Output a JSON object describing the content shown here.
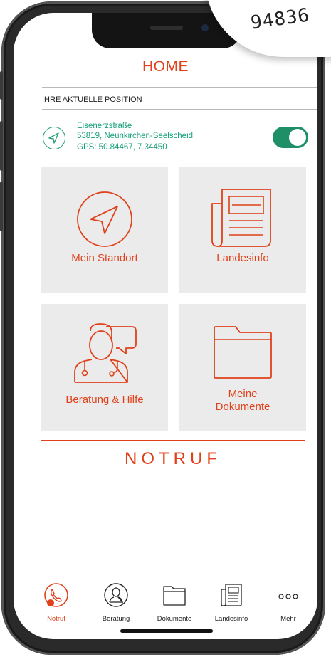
{
  "sticker": {
    "text": "94836"
  },
  "header": {
    "title": "HOME"
  },
  "position": {
    "label": "IHRE AKTUELLE POSITION",
    "street": "Eisenerzstraße",
    "city": "53819, Neunkirchen-Seelscheid",
    "gps": "GPS: 50.84467, 7.34450",
    "location_enabled": true
  },
  "tiles": [
    {
      "label": "Mein Standort",
      "icon": "navigation-arrow-icon"
    },
    {
      "label": "Landesinfo",
      "icon": "newspaper-icon"
    },
    {
      "label": "Beratung & Hilfe",
      "icon": "doctor-chat-icon"
    },
    {
      "label": "Meine Dokumente",
      "icon": "folder-icon"
    }
  ],
  "emergency": {
    "label": "NOTRUF"
  },
  "tabbar": {
    "items": [
      {
        "label": "Notruf",
        "icon": "phone-icon",
        "active": true
      },
      {
        "label": "Beratung",
        "icon": "doctor-icon",
        "active": false
      },
      {
        "label": "Dokumente",
        "icon": "folder-icon",
        "active": false
      },
      {
        "label": "Landesinfo",
        "icon": "newspaper-icon",
        "active": false
      },
      {
        "label": "Mehr",
        "icon": "more-dots-icon",
        "active": false
      }
    ]
  },
  "colors": {
    "accent": "#e0411b",
    "green": "#1e8f67",
    "tile_bg": "#ebebeb"
  }
}
